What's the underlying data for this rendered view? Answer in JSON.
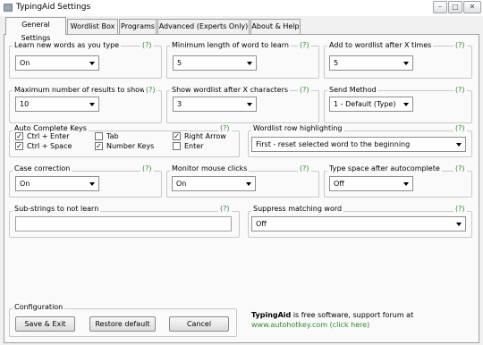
{
  "window": {
    "title": "TypingAid Settings"
  },
  "tabs": [
    {
      "label": "General Settings"
    },
    {
      "label": "Wordlist Box"
    },
    {
      "label": "Programs"
    },
    {
      "label": "Advanced (Experts Only)"
    },
    {
      "label": "About & Help"
    }
  ],
  "help_text": "(?)",
  "settings": {
    "learn_new_words": {
      "label": "Learn new words as you type",
      "value": "On"
    },
    "min_length": {
      "label": "Minimum length of word to learn",
      "value": "5"
    },
    "add_after_x": {
      "label": "Add to wordlist after X times",
      "value": "5"
    },
    "max_results": {
      "label": "Maximum number of results to show",
      "value": "10"
    },
    "show_after_x": {
      "label": "Show wordlist after X characters",
      "value": "3"
    },
    "send_method": {
      "label": "Send Method",
      "value": "1 - Default (Type)"
    },
    "row_highlighting": {
      "label": "Wordlist row highlighting",
      "value": "First - reset selected word to the beginning"
    },
    "case_correction": {
      "label": "Case correction",
      "value": "On"
    },
    "monitor_mouse": {
      "label": "Monitor mouse clicks",
      "value": "On"
    },
    "type_space": {
      "label": "Type space after autocomplete",
      "value": "Off"
    },
    "substrings": {
      "label": "Sub-strings to not learn",
      "value": ""
    },
    "suppress": {
      "label": "Suppress matching word",
      "value": "Off"
    }
  },
  "autocomplete_keys": {
    "label": "Auto Complete Keys",
    "keys": [
      {
        "label": "Ctrl + Enter",
        "checked": true
      },
      {
        "label": "Ctrl + Space",
        "checked": true
      },
      {
        "label": "Tab",
        "checked": false
      },
      {
        "label": "Number Keys",
        "checked": true
      },
      {
        "label": "Right Arrow",
        "checked": true
      },
      {
        "label": "Enter",
        "checked": false
      }
    ]
  },
  "configuration": {
    "label": "Configuration",
    "save_exit": "Save & Exit",
    "restore": "Restore default",
    "cancel": "Cancel"
  },
  "footer": {
    "app_name": "TypingAid",
    "text": " is free software, support forum at",
    "link": "www.autohotkey.com (click here)"
  }
}
